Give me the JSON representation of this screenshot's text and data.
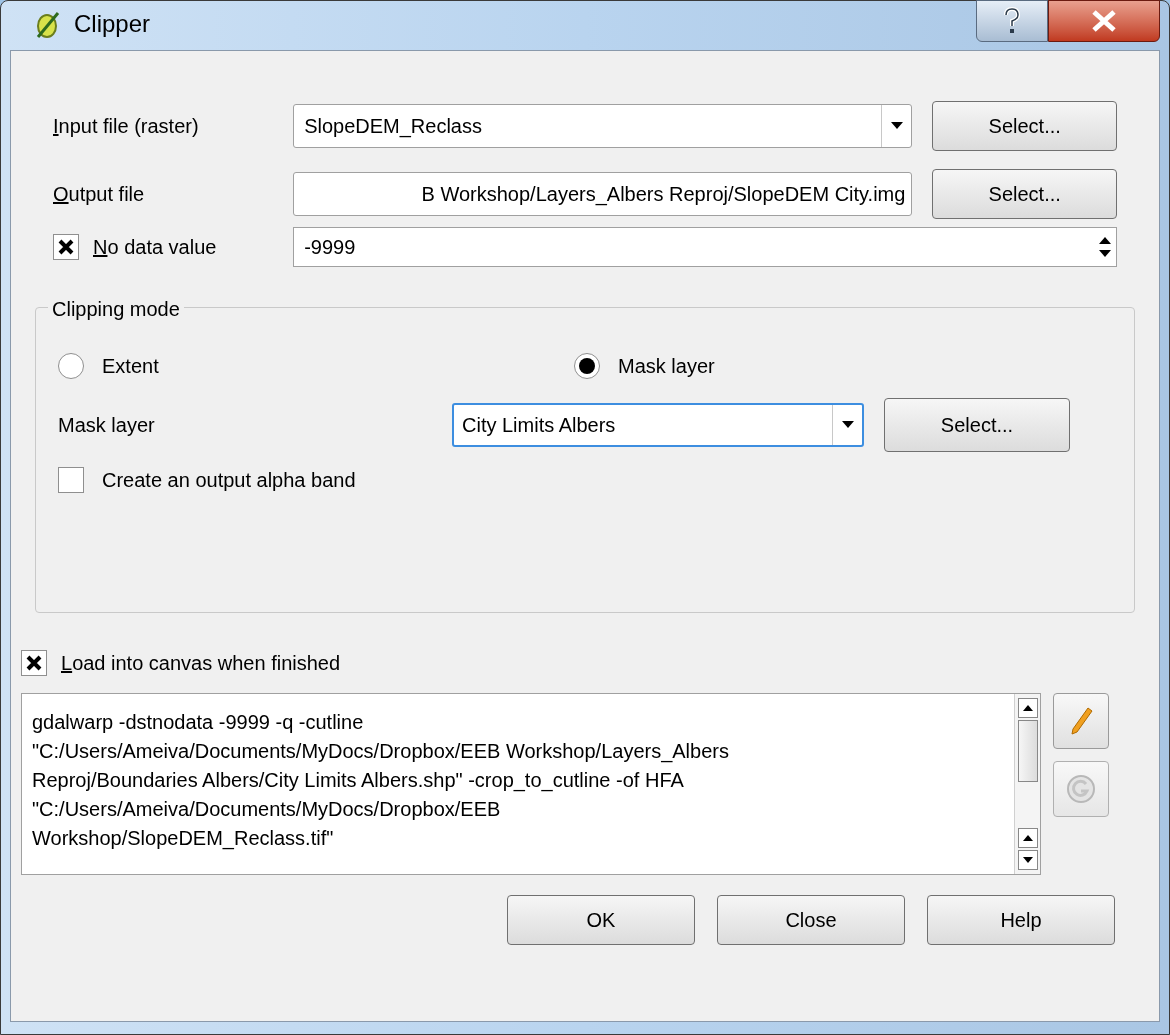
{
  "window": {
    "title": "Clipper"
  },
  "input_file": {
    "label": "Input file (raster)",
    "value": "SlopeDEM_Reclass",
    "button": "Select..."
  },
  "output_file": {
    "label": "Output file",
    "value": "B Workshop/Layers_Albers Reproj/SlopeDEM City.img",
    "button": "Select..."
  },
  "no_data": {
    "label": "No data value",
    "checked": true,
    "value": "-9999"
  },
  "clipping_mode": {
    "title": "Clipping mode",
    "options": [
      {
        "label": "Extent",
        "selected": false
      },
      {
        "label": "Mask layer",
        "selected": true
      }
    ],
    "mask_layer": {
      "label": "Mask layer",
      "value": "City Limits Albers",
      "button": "Select..."
    },
    "alpha_band": {
      "label": "Create an output alpha band",
      "checked": false
    }
  },
  "load_canvas": {
    "label": "Load into canvas when finished",
    "checked": true
  },
  "command_lines": [
    "gdalwarp -dstnodata -9999 -q -cutline",
    "\"C:/Users/Ameiva/Documents/MyDocs/Dropbox/EEB Workshop/Layers_Albers",
    "Reproj/Boundaries Albers/City Limits Albers.shp\" -crop_to_cutline -of HFA",
    "\"C:/Users/Ameiva/Documents/MyDocs/Dropbox/EEB",
    "Workshop/SlopeDEM_Reclass.tif\""
  ],
  "buttons": [
    "OK",
    "Close",
    "Help"
  ]
}
